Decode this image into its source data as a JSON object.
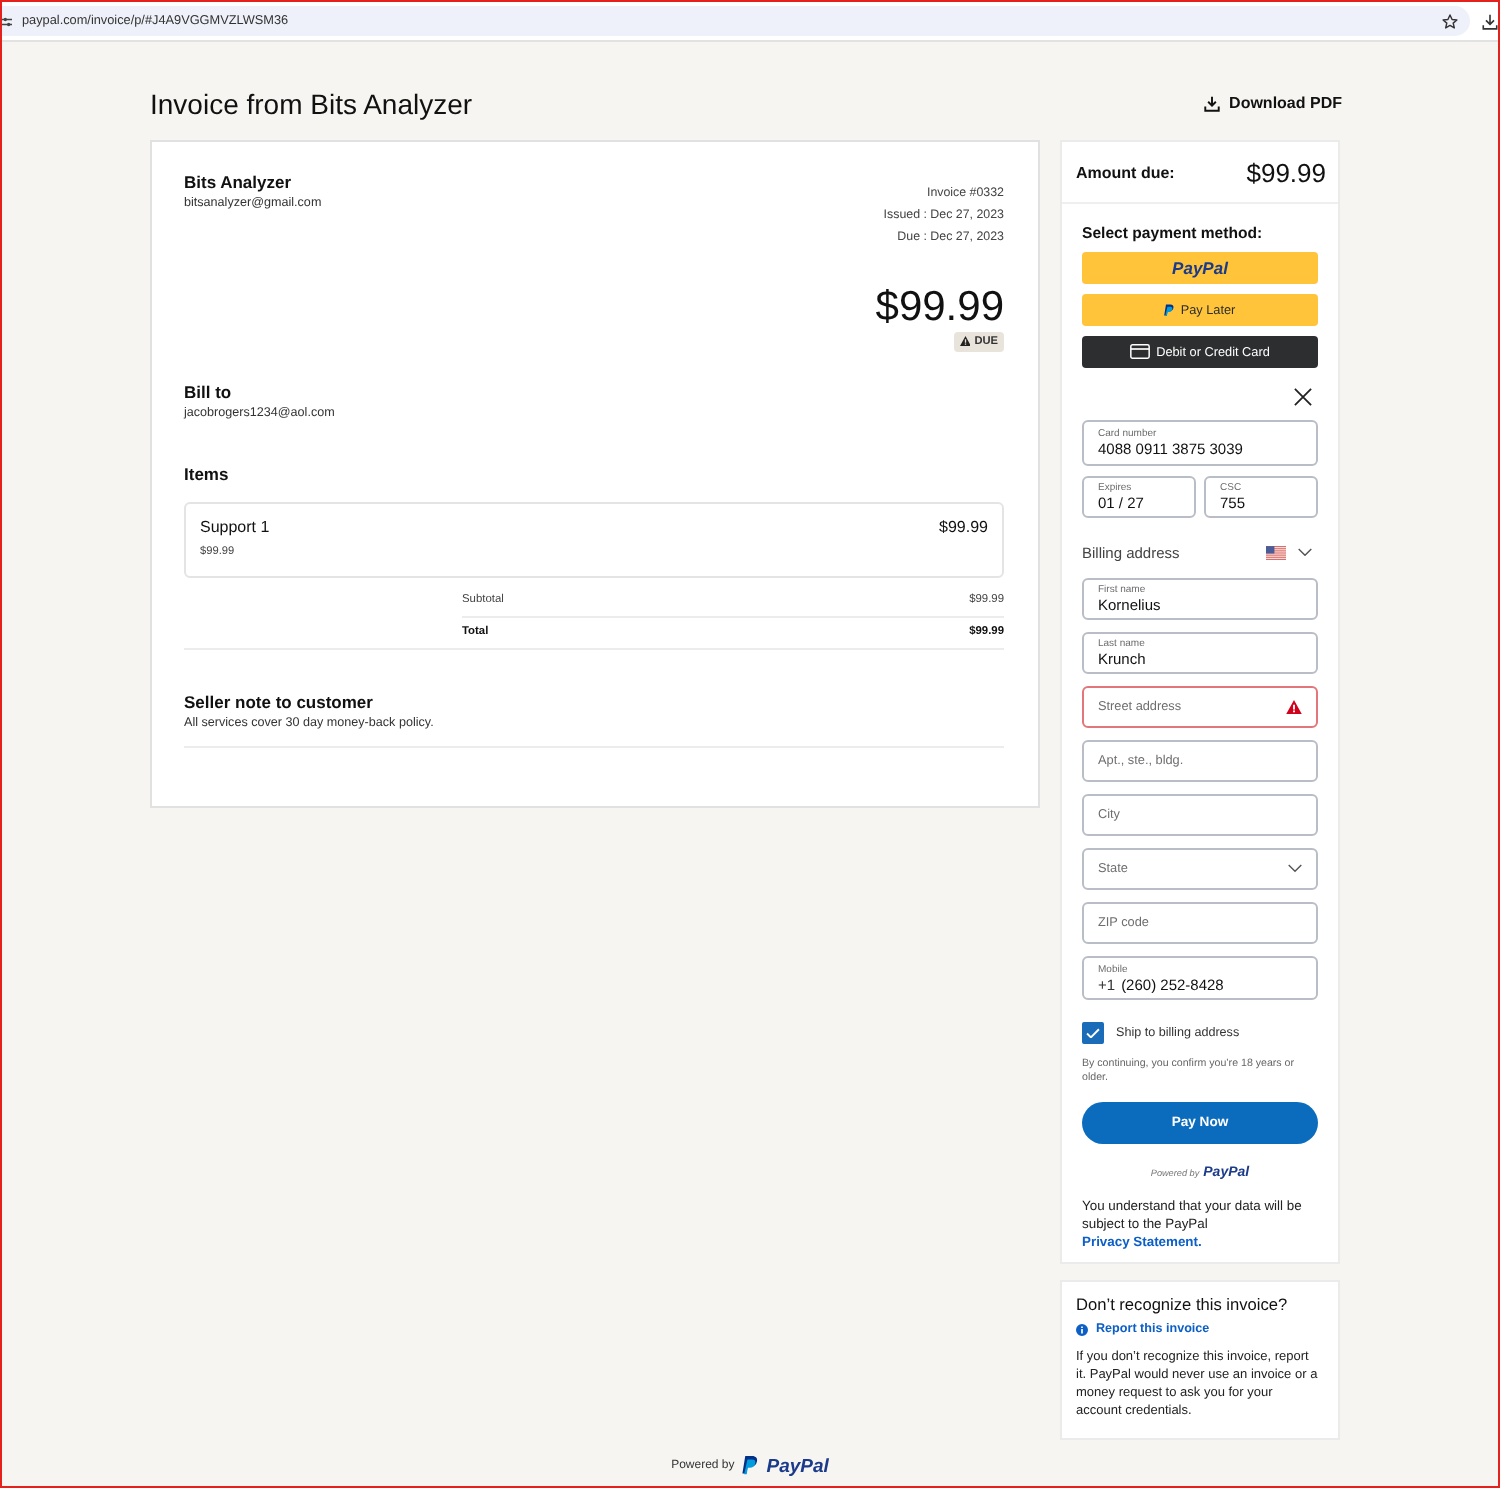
{
  "browser": {
    "url": "paypal.com/invoice/p/#J4A9VGGMVZLWSM36"
  },
  "header": {
    "title": "Invoice from Bits Analyzer",
    "download_label": "Download PDF"
  },
  "invoice": {
    "seller_name": "Bits Analyzer",
    "seller_email": "bitsanalyzer@gmail.com",
    "meta": [
      "Invoice #0332",
      "Issued : Dec 27, 2023",
      "Due : Dec 27, 2023"
    ],
    "amount": "$99.99",
    "status": "DUE",
    "bill_to_label": "Bill to",
    "bill_to_email": "jacobrogers1234@aol.com",
    "items_label": "Items",
    "items": [
      {
        "name": "Support 1",
        "amount": "$99.99",
        "unit_price": "$99.99"
      }
    ],
    "totals": [
      {
        "kind": "subtotal",
        "label": "Subtotal",
        "value": "$99.99"
      },
      {
        "kind": "total",
        "label": "Total",
        "value": "$99.99"
      }
    ],
    "note_title": "Seller note to customer",
    "note": "All services cover 30 day money-back policy."
  },
  "payment": {
    "amount_label": "Amount due:",
    "amount": "$99.99",
    "method_title": "Select payment method:",
    "methods": [
      {
        "kind": "paypal",
        "label": "PayPal"
      },
      {
        "kind": "paylater",
        "label": "Pay Later"
      },
      {
        "kind": "card",
        "label": "Debit or Credit Card"
      }
    ],
    "card_fields": [
      {
        "label": "Card number",
        "value": "4088 0911 3875 3039"
      },
      {
        "label": "Expires",
        "value": "01 / 27"
      },
      {
        "label": "CSC",
        "value": "755"
      }
    ],
    "billing_title": "Billing address",
    "address_fields": [
      {
        "kind": "text",
        "label": "First name",
        "value": "Kornelius",
        "error": false
      },
      {
        "kind": "text",
        "label": "Last name",
        "value": "Krunch",
        "error": false
      },
      {
        "kind": "text",
        "placeholder": "Street address",
        "error": true
      },
      {
        "kind": "text",
        "placeholder": "Apt., ste., bldg.",
        "error": false
      },
      {
        "kind": "text",
        "placeholder": "City",
        "error": false
      },
      {
        "kind": "select",
        "placeholder": "State",
        "error": false
      },
      {
        "kind": "text",
        "placeholder": "ZIP code",
        "error": false
      },
      {
        "kind": "phone",
        "label": "Mobile",
        "prefix": "+1",
        "value": "(260) 252-8428",
        "error": false
      }
    ],
    "ship_to_billing": {
      "label": "Ship to billing address",
      "checked": true
    },
    "consent": "By continuing, you confirm you’re 18 years or older.",
    "pay_button": "Pay Now",
    "powered_by": {
      "prefix": "Powered by",
      "logo": "PayPal"
    },
    "privacy": {
      "text": "You understand that your data will be subject to the PayPal",
      "link": "Privacy Statement."
    }
  },
  "report": {
    "title": "Don’t recognize this invoice?",
    "link": "Report this invoice",
    "body": "If you don’t recognize this invoice, report it. PayPal would never use an invoice or a money request to ask you for your account credentials."
  },
  "footer": {
    "prefix": "Powered by",
    "logo": "PayPal"
  }
}
